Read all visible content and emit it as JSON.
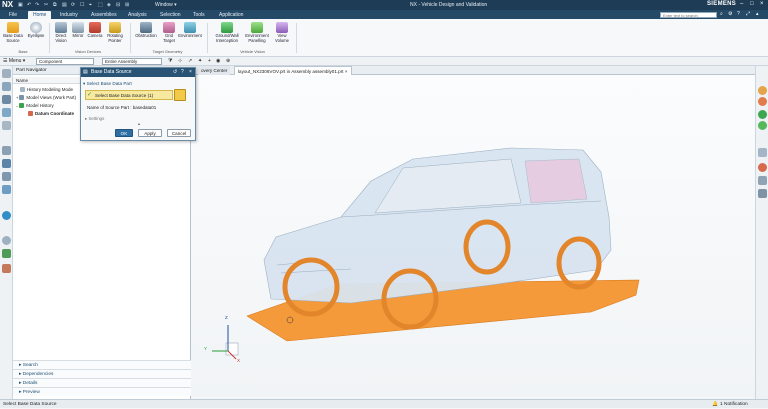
{
  "app": {
    "logo": "NX",
    "window_title": "NX - Vehicle Design and Validation",
    "window_menu": "Window",
    "brand": "SIEMENS",
    "search_placeholder": "Enter text to search"
  },
  "menu_tabs": [
    "File",
    "Home",
    "Industry",
    "Assemblies",
    "Analysis",
    "Selection",
    "Tools",
    "Application"
  ],
  "active_menu_tab": "Home",
  "ribbon": {
    "buttons": [
      {
        "label": "Base Data\nSource"
      },
      {
        "label": "Eyellipse"
      },
      {
        "label": "Direct\nVision"
      },
      {
        "label": "Mirror"
      },
      {
        "label": "Camera"
      },
      {
        "label": "Rotating\nPointer"
      },
      {
        "label": "Obstruction"
      },
      {
        "label": "Grid\nTarget"
      },
      {
        "label": "Environment"
      },
      {
        "label": "Ground/Wall\nInterception"
      },
      {
        "label": "Environment\nPanelling"
      },
      {
        "label": "View\nVolume"
      }
    ],
    "groups": [
      "Base",
      "Vision Devices",
      "Target Geometry",
      "Vehicle Vision"
    ]
  },
  "toolbar": {
    "menu_label": "Menu",
    "filter_value": "Component",
    "scope_value": "Entire Assembly"
  },
  "doc_tabs": [
    "overy Center",
    "layout_NX2306VOV.prt in Assembly assembly01.prt"
  ],
  "navigator": {
    "title": "Part Navigator",
    "column_name": "Name",
    "tree": [
      {
        "label": "History Modeling Mode",
        "indent": 1
      },
      {
        "label": "Model Views (Work Part)",
        "indent": 1
      },
      {
        "label": "Model History",
        "indent": 1
      },
      {
        "label": "Datum Coordinate",
        "indent": 2
      }
    ],
    "bottom_panels": [
      "Search",
      "Dependencies",
      "Details",
      "Preview"
    ]
  },
  "dialog": {
    "title": "Base Data Source",
    "section": "Select Base Data Part",
    "selection_text": "Select Base Data Source (1)",
    "name_label": "Name of Source Part : basedata01",
    "settings_label": "Settings",
    "ok": "OK",
    "apply": "Apply",
    "cancel": "Cancel"
  },
  "axes": {
    "x": "X",
    "y": "Y",
    "z": "Z"
  },
  "status": {
    "left": "Select Base Data Source",
    "right": "1 Notification"
  },
  "colors": {
    "title_bar": "#1e3c55",
    "menu_bar": "#254a68",
    "dialog_header": "#2a5475",
    "selection_highlight": "#f7eaa0",
    "ground_plane": "#f59a3a",
    "car_body": "#d8e4f0"
  }
}
